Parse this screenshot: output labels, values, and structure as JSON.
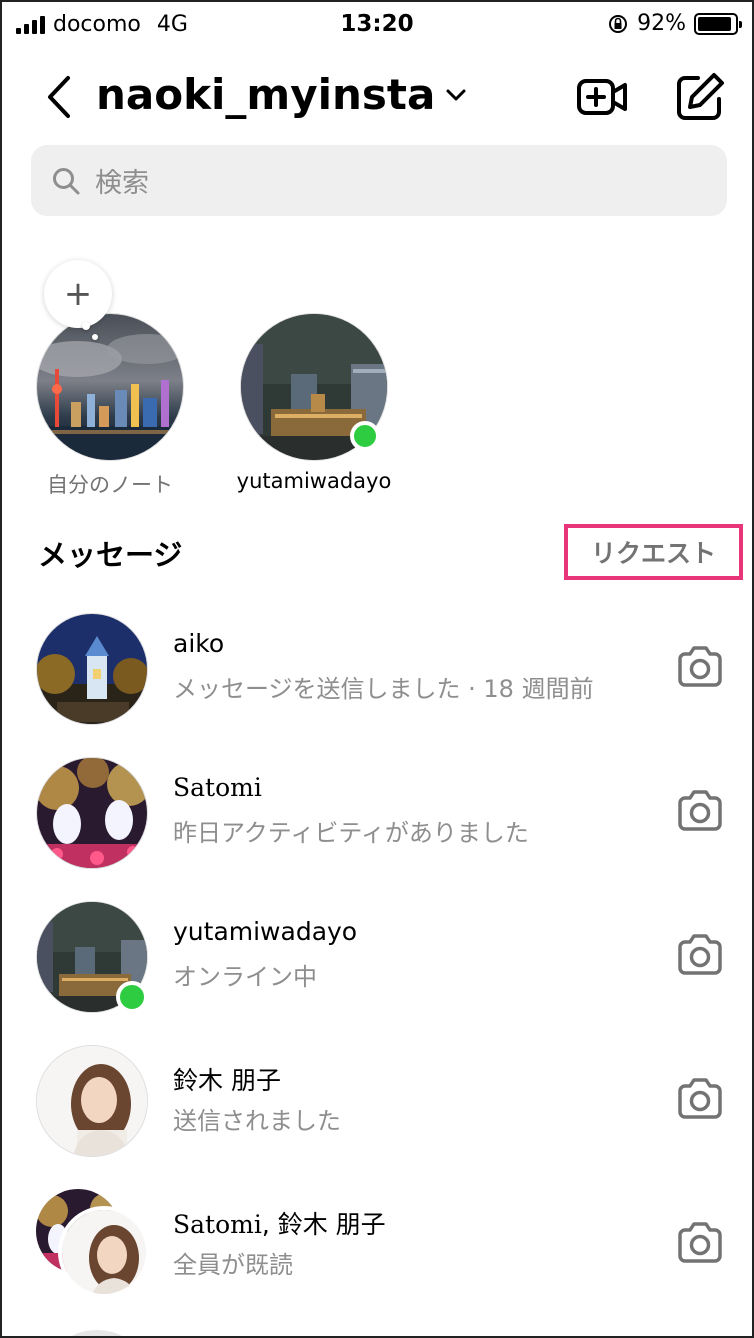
{
  "status": {
    "carrier": "docomo",
    "network": "4G",
    "time": "13:20",
    "battery": "92%",
    "battery_level": 0.92
  },
  "header": {
    "account": "naoki_myinsta"
  },
  "search": {
    "placeholder": "検索"
  },
  "notes": [
    {
      "label": "自分のノート",
      "add": "+"
    },
    {
      "label": "yutamiwadayo",
      "online": true
    }
  ],
  "messages_section": {
    "title": "メッセージ",
    "requests_label": "リクエスト"
  },
  "threads": [
    {
      "name": "aiko",
      "subtitle": "メッセージを送信しました · 18 週間前"
    },
    {
      "name": "Satomi",
      "subtitle": "昨日アクティビティがありました"
    },
    {
      "name": "yutamiwadayo",
      "subtitle": "オンライン中",
      "online": true
    },
    {
      "name": "鈴木 朋子",
      "subtitle": "送信されました"
    },
    {
      "name_a": "Satomi",
      "name_b": ", 鈴木 朋子",
      "subtitle": "全員が既読"
    }
  ],
  "colors": {
    "highlight": "#e8357a",
    "online": "#2ecc40",
    "muted": "#8e8e8e"
  }
}
